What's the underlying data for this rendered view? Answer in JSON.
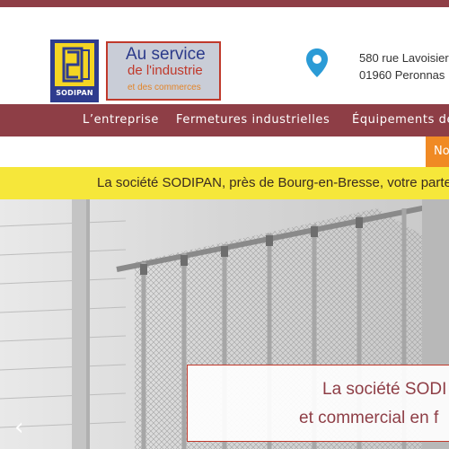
{
  "brand": {
    "logo_text": "SODIPAN",
    "tagline_line1": "Au service",
    "tagline_line2": "de l'industrie",
    "tagline_line3": "et des commerces"
  },
  "address": {
    "line1": "580 rue Lavoisier",
    "line2": "01960 Peronnas"
  },
  "nav": {
    "items": [
      "L’entreprise",
      "Fermetures industrielles",
      "Équipements de"
    ],
    "contact_label": "No"
  },
  "ribbon": {
    "text": "La société SODIPAN, près de Bourg-en-Bresse, votre parten"
  },
  "hero": {
    "caption_line1": "La société SODI",
    "caption_line2": "et commercial en f",
    "prev_icon": "chevron-left-icon"
  },
  "colors": {
    "brand_maroon": "#8e3e46",
    "accent_orange": "#f08a24",
    "ribbon_yellow": "#f6e73a",
    "logo_blue": "#2e3c8e",
    "logo_yellow": "#f4d523"
  }
}
